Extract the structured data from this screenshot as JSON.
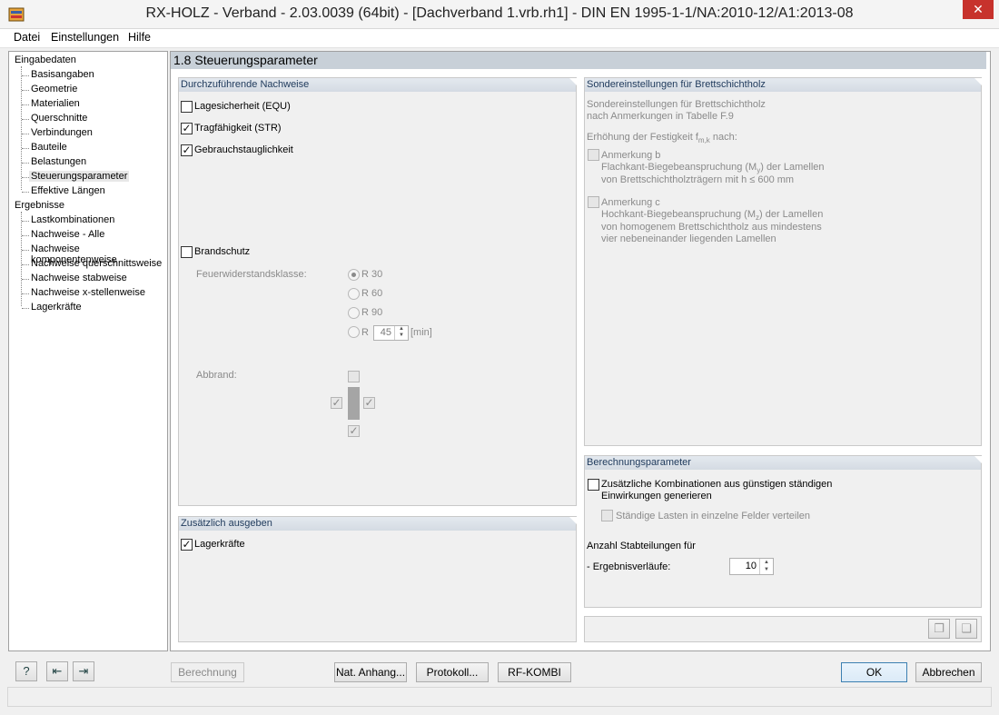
{
  "window": {
    "title": "RX-HOLZ - Verband - 2.03.0039 (64bit) - [Dachverband 1.vrb.rh1] - DIN EN 1995-1-1/NA:2010-12/A1:2013-08",
    "close_glyph": "✕"
  },
  "menu": [
    "Datei",
    "Einstellungen",
    "Hilfe"
  ],
  "nav": {
    "input_root": "Eingabedaten",
    "input_items": [
      "Basisangaben",
      "Geometrie",
      "Materialien",
      "Querschnitte",
      "Verbindungen",
      "Bauteile",
      "Belastungen",
      "Steuerungsparameter",
      "Effektive Längen"
    ],
    "results_root": "Ergebnisse",
    "results_items": [
      "Lastkombinationen",
      "Nachweise - Alle",
      "Nachweise komponentenweise",
      "Nachweise querschnittsweise",
      "Nachweise stabweise",
      "Nachweise x-stellenweise",
      "Lagerkräfte"
    ]
  },
  "page_title": "1.8 Steuerungsparameter",
  "nachweise": {
    "header": "Durchzuführende Nachweise",
    "equ": "Lagesicherheit (EQU)",
    "str": "Tragfähigkeit (STR)",
    "gebrauch": "Gebrauchstauglichkeit",
    "brandschutz": "Brandschutz",
    "feuerwiderstand_label": "Feuerwiderstandsklasse:",
    "r30": "R 30",
    "r60": "R 60",
    "r90": "R 90",
    "r_custom": "R",
    "r_custom_value": "45",
    "r_custom_unit": "[min]",
    "abbrand_label": "Abbrand:"
  },
  "zusaetzlich": {
    "header": "Zusätzlich ausgeben",
    "lagerkraefte": "Lagerkräfte"
  },
  "sonder": {
    "header": "Sondereinstellungen für Brettschichtholz",
    "desc1": "Sondereinstellungen für Brettschichtholz",
    "desc2": "nach Anmerkungen in Tabelle F.9",
    "erhoehung": "Erhöhung der Festigkeit f",
    "erhoehung_sub": "m,k",
    "erhoehung_suffix": " nach:",
    "anm_b_title": "Anmerkung b",
    "anm_b_line1_pre": "Flachkant-Biegebeanspruchung (M",
    "anm_b_line1_sub": "y",
    "anm_b_line1_post": ") der Lamellen",
    "anm_b_line2": "von Brettschichtholzträgern mit h ≤ 600 mm",
    "anm_c_title": "Anmerkung c",
    "anm_c_line1_pre": "Hochkant-Biegebeanspruchung (M",
    "anm_c_line1_sub": "z",
    "anm_c_line1_post": ") der Lamellen",
    "anm_c_line2": "von homogenem Brettschichtholz aus mindestens",
    "anm_c_line3": "vier nebeneinander liegenden Lamellen"
  },
  "berechnung": {
    "header": "Berechnungsparameter",
    "zus_kombi_line1": "Zusätzliche Kombinationen aus günstigen ständigen",
    "zus_kombi_line2": "Einwirkungen generieren",
    "staendige": "Ständige Lasten in einzelne Felder verteilen",
    "anzahl_label": "Anzahl Stabteilungen für",
    "ergebnis_label": "- Ergebnisverläufe:",
    "ergebnis_value": "10"
  },
  "buttons": {
    "berechnung": "Berechnung",
    "nat_anhang": "Nat. Anhang...",
    "protokoll": "Protokoll...",
    "rfkombi": "RF-KOMBI",
    "ok": "OK",
    "abbrechen": "Abbrechen"
  },
  "check_glyph": "✓",
  "icons": {
    "help": "?",
    "prev": "⇤",
    "next": "⇥",
    "copy": "❐",
    "paste": "❏",
    "spin_up": "▲",
    "spin_down": "▼"
  }
}
